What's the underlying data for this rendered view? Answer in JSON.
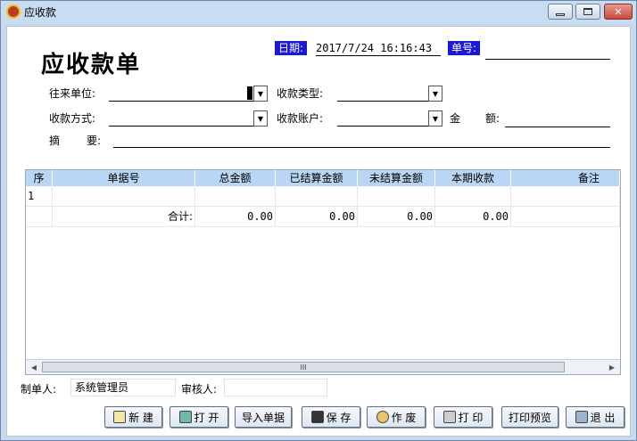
{
  "window": {
    "title": "应收款"
  },
  "form": {
    "title": "应收款单",
    "date_label": "日期:",
    "date_value": "2017/7/24 16:16:43",
    "doc_no_label": "单号:",
    "doc_no_value": "",
    "partner_label": "往来单位:",
    "partner_value": "",
    "type_label": "收款类型:",
    "type_value": "",
    "method_label": "收款方式:",
    "method_value": "",
    "account_label": "收款账户:",
    "account_value": "",
    "amount_label_1": "金",
    "amount_label_2": "额:",
    "amount_value": "",
    "summary_label_1": "摘",
    "summary_label_2": "要:",
    "summary_value": ""
  },
  "grid": {
    "columns": [
      "序",
      "单据号",
      "总金额",
      "已结算金额",
      "未结算金额",
      "本期收款",
      "备注"
    ],
    "rows": [
      {
        "seq": "1",
        "doc": "",
        "total": "",
        "settled": "",
        "unsettled": "",
        "current": "",
        "note": ""
      }
    ],
    "total_row": {
      "label": "合计:",
      "total": "0.00",
      "settled": "0.00",
      "unsettled": "0.00",
      "current": "0.00"
    },
    "scroll_thumb_glyph": "III"
  },
  "footer": {
    "maker_label": "制单人:",
    "maker_value": "系统管理员",
    "reviewer_label": "审核人:",
    "reviewer_value": ""
  },
  "toolbar": {
    "new_label": "新  建",
    "open_label": "打 开",
    "import_label": "导入单据",
    "save_label": "保  存",
    "void_label": "作  废",
    "print_label": "打  印",
    "preview_label": "打印预览",
    "exit_label": "退  出"
  },
  "colors": {
    "tag_bg": "#1a1ad6",
    "grid_header": "#b9d6f4",
    "close_btn": "#c74a3b"
  },
  "icons": [
    "app-icon",
    "minimize-icon",
    "maximize-icon",
    "close-icon",
    "dropdown-arrow-icon",
    "new-icon",
    "open-icon",
    "save-icon",
    "void-icon",
    "print-icon",
    "exit-icon"
  ]
}
